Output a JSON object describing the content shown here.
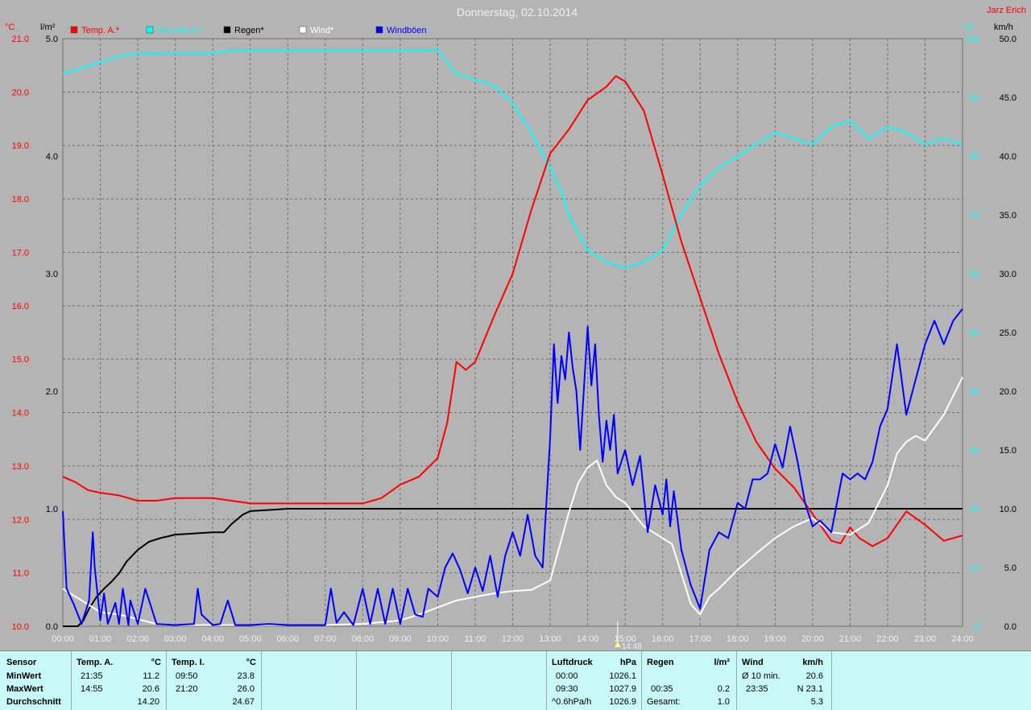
{
  "chart_data": {
    "type": "line",
    "title": "Donnerstag, 02.10.2014",
    "author": "Jarz Erich",
    "legend": [
      {
        "name": "Temp. A.*",
        "color": "#ff0000"
      },
      {
        "name": "Feuchte A.*",
        "color": "#00ffff"
      },
      {
        "name": "Regen*",
        "color": "#000000"
      },
      {
        "name": "Wind*",
        "color": "#ffffff"
      },
      {
        "name": "Windböen",
        "color": "#0000ff"
      }
    ],
    "axes": {
      "temp": {
        "unit": "°C",
        "range": [
          10,
          21
        ],
        "ticks": [
          "10.0",
          "11.0",
          "12.0",
          "13.0",
          "14.0",
          "15.0",
          "16.0",
          "17.0",
          "18.0",
          "19.0",
          "20.0",
          "21.0"
        ]
      },
      "rain": {
        "unit": "l/m²",
        "range": [
          0,
          5
        ],
        "ticks": [
          "0.0",
          "1.0",
          "2.0",
          "3.0",
          "4.0",
          "5.0"
        ]
      },
      "humidity": {
        "unit": "%",
        "range": [
          0,
          100
        ],
        "ticks": [
          "0",
          "10",
          "20",
          "30",
          "40",
          "50",
          "60",
          "70",
          "80",
          "90",
          "100"
        ]
      },
      "wind": {
        "unit": "km/h",
        "range": [
          0,
          50
        ],
        "ticks": [
          "0.0",
          "5.0",
          "10.0",
          "15.0",
          "20.0",
          "25.0",
          "30.0",
          "35.0",
          "40.0",
          "45.0",
          "50.0"
        ]
      },
      "x": {
        "ticks": [
          "00:00",
          "01:00",
          "02:00",
          "03:00",
          "04:00",
          "05:00",
          "06:00",
          "07:00",
          "08:00",
          "09:00",
          "10:00",
          "11:00",
          "12:00",
          "13:00",
          "14:00",
          "15:00",
          "16:00",
          "17:00",
          "18:00",
          "19:00",
          "20:00",
          "21:00",
          "22:00",
          "23:00",
          "24:00"
        ]
      }
    },
    "marker": {
      "label": "14:48",
      "hour": 14.8
    },
    "grid": true,
    "series": [
      {
        "name": "Temp. A.*",
        "axis": "temp",
        "color": "#ff0000",
        "hours": [
          0,
          0.33,
          0.67,
          1,
          1.5,
          2,
          2.5,
          3,
          3.5,
          4,
          4.5,
          5,
          6,
          7,
          8,
          8.5,
          9,
          9.5,
          10,
          10.25,
          10.5,
          10.75,
          11,
          11.5,
          12,
          12.5,
          13,
          13.5,
          14,
          14.5,
          14.75,
          15,
          15.5,
          16,
          16.5,
          17,
          17.5,
          18,
          18.5,
          19,
          19.5,
          20,
          20.5,
          20.75,
          21,
          21.25,
          21.6,
          22,
          22.5,
          23,
          23.5,
          24
        ],
        "values": [
          12.8,
          12.7,
          12.55,
          12.5,
          12.45,
          12.35,
          12.35,
          12.4,
          12.4,
          12.4,
          12.35,
          12.3,
          12.3,
          12.3,
          12.3,
          12.4,
          12.65,
          12.8,
          13.15,
          13.8,
          14.95,
          14.8,
          14.95,
          15.8,
          16.6,
          17.8,
          18.85,
          19.3,
          19.85,
          20.1,
          20.3,
          20.2,
          19.65,
          18.45,
          17.2,
          16.15,
          15.1,
          14.2,
          13.45,
          12.95,
          12.6,
          12.1,
          11.6,
          11.55,
          11.85,
          11.65,
          11.5,
          11.65,
          12.15,
          11.9,
          11.6,
          11.7
        ]
      },
      {
        "name": "Feuchte A.*",
        "axis": "humidity",
        "color": "#00ffff",
        "hours": [
          0,
          0.5,
          1,
          1.5,
          2,
          3,
          4,
          4.5,
          5,
          6,
          7,
          8,
          9,
          10,
          10.5,
          11,
          11.5,
          12,
          12.5,
          13,
          13.3,
          13.5,
          14,
          14.5,
          15,
          15.5,
          16,
          16.5,
          17,
          17.5,
          18,
          18.5,
          19,
          19.5,
          20,
          20.5,
          21,
          21.5,
          22,
          22.5,
          23,
          23.5,
          24
        ],
        "values": [
          94,
          95,
          96,
          97,
          97.5,
          97.5,
          97.5,
          98,
          98,
          98,
          98,
          98,
          98,
          98,
          94,
          93,
          92,
          89,
          84,
          78,
          74,
          70,
          64,
          62,
          61,
          62,
          64,
          70,
          75,
          78,
          80,
          82,
          84,
          83,
          82,
          85,
          86,
          83,
          85,
          84,
          82,
          83,
          82
        ]
      },
      {
        "name": "Regen*",
        "axis": "rain",
        "color": "#000000",
        "hours": [
          0,
          0.4,
          0.55,
          0.7,
          0.9,
          1.1,
          1.3,
          1.5,
          1.7,
          2,
          2.3,
          2.6,
          3,
          3.5,
          4,
          4.3,
          4.5,
          4.8,
          5,
          5.5,
          6,
          8,
          10,
          12,
          15,
          18,
          20,
          22,
          24
        ],
        "values": [
          0,
          0,
          0.05,
          0.15,
          0.25,
          0.32,
          0.38,
          0.45,
          0.55,
          0.65,
          0.72,
          0.75,
          0.78,
          0.79,
          0.8,
          0.8,
          0.87,
          0.95,
          0.98,
          0.99,
          1.0,
          1.0,
          1.0,
          1.0,
          1.0,
          1.0,
          1.0,
          1.0,
          1.0
        ]
      },
      {
        "name": "Wind*",
        "axis": "wind",
        "color": "#ffffff",
        "hours": [
          0,
          0.5,
          1,
          1.5,
          2,
          2.5,
          3,
          4,
          5,
          6,
          7,
          8,
          9,
          9.5,
          10,
          10.5,
          11,
          11.5,
          12,
          12.5,
          13,
          13.25,
          13.5,
          13.75,
          14,
          14.25,
          14.5,
          14.75,
          15,
          15.25,
          15.5,
          15.75,
          16,
          16.25,
          16.5,
          16.75,
          17,
          17.25,
          17.5,
          18,
          18.5,
          19,
          19.5,
          20,
          20.5,
          21,
          21.5,
          22,
          22.25,
          22.5,
          22.75,
          23,
          23.5,
          24
        ],
        "values": [
          3.2,
          2.2,
          1.2,
          1.0,
          0.6,
          0.2,
          0.1,
          0.1,
          0.1,
          0.1,
          0.1,
          0.2,
          0.5,
          1.0,
          1.6,
          2.2,
          2.5,
          2.8,
          3.0,
          3.1,
          3.9,
          6.8,
          9.7,
          12.2,
          13.5,
          14.1,
          12.0,
          11.0,
          10.5,
          9.5,
          8.5,
          8.0,
          7.5,
          7.0,
          4.5,
          1.9,
          1.0,
          2.5,
          3.2,
          4.8,
          6.2,
          7.5,
          8.5,
          9.2,
          8.0,
          7.8,
          8.8,
          12.0,
          14.7,
          15.7,
          16.2,
          15.8,
          18.0,
          21.2
        ]
      },
      {
        "name": "Windböen",
        "axis": "wind",
        "color": "#0000ff",
        "hours": [
          0,
          0.1,
          0.3,
          0.5,
          0.7,
          0.8,
          0.85,
          1,
          1.1,
          1.2,
          1.4,
          1.5,
          1.6,
          1.75,
          1.8,
          2,
          2.2,
          2.5,
          3,
          3.5,
          3.6,
          3.7,
          4,
          4.2,
          4.4,
          4.6,
          5,
          5.5,
          6,
          6.5,
          7,
          7.15,
          7.3,
          7.5,
          7.75,
          8,
          8.2,
          8.4,
          8.6,
          8.8,
          9,
          9.2,
          9.4,
          9.6,
          9.75,
          10,
          10.2,
          10.4,
          10.6,
          10.8,
          11,
          11.2,
          11.4,
          11.6,
          11.8,
          12,
          12.2,
          12.4,
          12.6,
          12.8,
          13,
          13.1,
          13.2,
          13.3,
          13.4,
          13.5,
          13.6,
          13.7,
          13.8,
          14,
          14.1,
          14.2,
          14.3,
          14.4,
          14.5,
          14.6,
          14.7,
          14.8,
          15,
          15.2,
          15.4,
          15.6,
          15.8,
          16,
          16.1,
          16.2,
          16.3,
          16.5,
          16.75,
          17,
          17.25,
          17.5,
          17.75,
          18,
          18.2,
          18.4,
          18.6,
          18.8,
          19,
          19.2,
          19.4,
          19.6,
          19.8,
          20,
          20.2,
          20.5,
          20.8,
          21,
          21.2,
          21.4,
          21.6,
          21.8,
          22,
          22.25,
          22.5,
          22.75,
          23,
          23.25,
          23.5,
          23.75,
          24
        ],
        "values": [
          9.8,
          3.2,
          1.8,
          0.2,
          2.2,
          8.0,
          5.0,
          0.5,
          2.8,
          0.2,
          2.0,
          0.2,
          3.2,
          0.1,
          2.2,
          0.2,
          3.2,
          0.2,
          0.1,
          0.2,
          3.2,
          1.0,
          0.1,
          0.2,
          2.2,
          0.1,
          0.1,
          0.2,
          0.1,
          0.1,
          0.1,
          3.2,
          0.3,
          1.2,
          0.1,
          3.2,
          0.2,
          3.2,
          0.2,
          3.2,
          0.2,
          3.2,
          1.0,
          0.8,
          3.2,
          2.5,
          5.0,
          6.2,
          4.8,
          2.8,
          5.0,
          3.0,
          6.0,
          2.5,
          6.0,
          8.0,
          6.0,
          9.5,
          6.0,
          5.0,
          16.0,
          24.0,
          19.0,
          23.0,
          21.0,
          25.0,
          22.0,
          20.0,
          15.0,
          25.5,
          20.5,
          24.0,
          18.0,
          14.0,
          17.5,
          15.0,
          18.0,
          13.0,
          15.0,
          12.0,
          14.5,
          8.0,
          12.0,
          9.5,
          12.5,
          8.5,
          11.5,
          6.5,
          3.5,
          1.5,
          6.5,
          8.0,
          7.5,
          10.5,
          10.0,
          12.5,
          12.5,
          13.0,
          15.5,
          13.5,
          17.0,
          14.0,
          10.5,
          8.5,
          9.0,
          8.0,
          13.0,
          12.5,
          13.0,
          12.5,
          14.0,
          17.0,
          18.5,
          24.0,
          18.0,
          21.0,
          24.0,
          26.0,
          24.0,
          26.0,
          27.0
        ]
      }
    ]
  },
  "summary": {
    "row_labels": [
      "Sensor",
      "MinWert",
      "MaxWert",
      "Durchschnitt"
    ],
    "temp_a": {
      "header": "Temp. A.",
      "unit": "°C",
      "min_time": "21:35",
      "min_value": "11.2",
      "max_time": "14:55",
      "max_value": "20.6",
      "avg": "14.20"
    },
    "temp_i": {
      "header": "Temp. I.",
      "unit": "°C",
      "min_time": "09:50",
      "min_value": "23.8",
      "max_time": "21:20",
      "max_value": "26.0",
      "avg": "24.67"
    },
    "pressure": {
      "header": "Luftdruck",
      "unit": "hPa",
      "min_time": "00:00",
      "min_value": "1026.1",
      "max_time": "09:30",
      "max_value": "1027.9",
      "avg_label": "^0.6hPa/h",
      "avg": "1026.9"
    },
    "rain": {
      "header": "Regen",
      "unit": "l/m²",
      "max_time": "00:35",
      "max_value": "0.2",
      "total_label": "Gesamt:",
      "total": "1.0"
    },
    "wind": {
      "header": "Wind",
      "unit": "km/h",
      "avg_label": "Ø 10 min.",
      "avg_value": "20.6",
      "max_time": "23:35",
      "max_value": "N 23.1",
      "daily_avg": "5.3"
    }
  }
}
